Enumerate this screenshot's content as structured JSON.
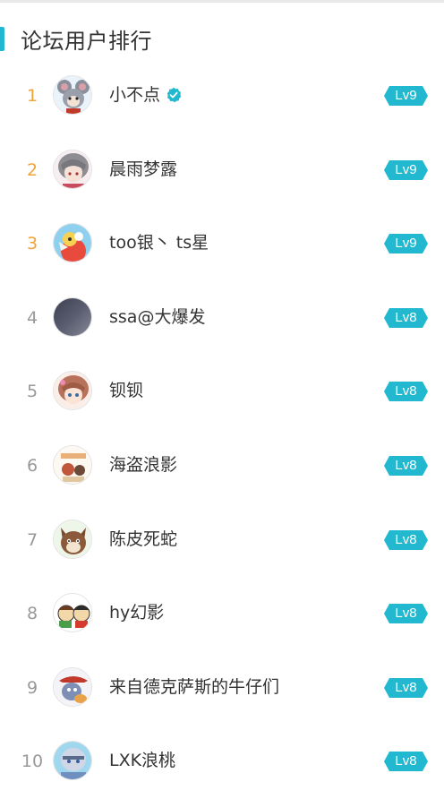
{
  "panel": {
    "title": "论坛用户排行",
    "accent_color": "#22b8cf"
  },
  "ranking": [
    {
      "rank": "1",
      "name": "小不点",
      "verified": true,
      "level": "Lv9",
      "avatar": "mouse-girl-avatar"
    },
    {
      "rank": "2",
      "name": "晨雨梦露",
      "verified": false,
      "level": "Lv9",
      "avatar": "anime-grey-hair-avatar"
    },
    {
      "rank": "3",
      "name": "too银丶 ts星",
      "verified": false,
      "level": "Lv9",
      "avatar": "colorful-character-avatar"
    },
    {
      "rank": "4",
      "name": "ssa@大爆发",
      "verified": false,
      "level": "Lv8",
      "avatar": "dark-gradient-avatar"
    },
    {
      "rank": "5",
      "name": "钡钡",
      "verified": false,
      "level": "Lv8",
      "avatar": "anime-girl-avatar"
    },
    {
      "rank": "6",
      "name": "海盗浪影",
      "verified": false,
      "level": "Lv8",
      "avatar": "pirate-cartoon-avatar"
    },
    {
      "rank": "7",
      "name": "陈皮死蛇",
      "verified": false,
      "level": "Lv8",
      "avatar": "brown-fox-avatar"
    },
    {
      "rank": "8",
      "name": "hy幻影",
      "verified": false,
      "level": "Lv8",
      "avatar": "cartoon-pair-avatar"
    },
    {
      "rank": "9",
      "name": "来自德克萨斯的牛仔们",
      "verified": false,
      "level": "Lv8",
      "avatar": "cowboy-cartoon-avatar"
    },
    {
      "rank": "10",
      "name": "LXK浪桃",
      "verified": false,
      "level": "Lv8",
      "avatar": "blue-character-avatar"
    }
  ],
  "colors": {
    "rank_top": "#f0a43a",
    "rank_other": "#999999",
    "level_badge": "#22b8cf",
    "verified_badge": "#22b8cf"
  }
}
